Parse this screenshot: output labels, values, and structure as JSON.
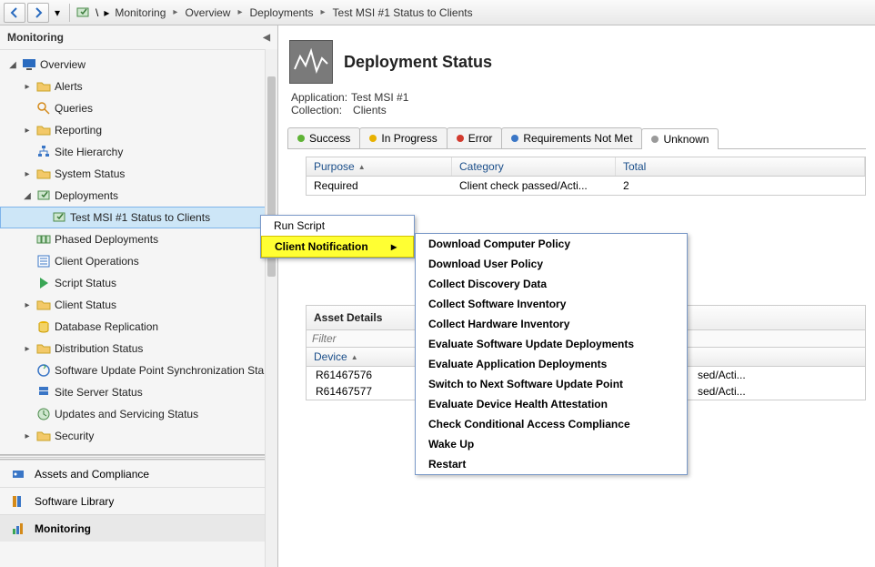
{
  "toolbar": {
    "breadcrumb": [
      "Monitoring",
      "Overview",
      "Deployments",
      "Test MSI #1 Status to Clients"
    ]
  },
  "nav": {
    "header": "Monitoring",
    "tree": {
      "overview": "Overview",
      "alerts": "Alerts",
      "queries": "Queries",
      "reporting": "Reporting",
      "site_hierarchy": "Site Hierarchy",
      "system_status": "System Status",
      "deployments": "Deployments",
      "test_msi": "Test MSI #1 Status to Clients",
      "phased_deployments": "Phased Deployments",
      "client_operations": "Client Operations",
      "script_status": "Script Status",
      "client_status": "Client Status",
      "database_replication": "Database Replication",
      "distribution_status": "Distribution Status",
      "sup_sync": "Software Update Point Synchronization Sta",
      "site_server_status": "Site Server Status",
      "updates_servicing": "Updates and Servicing Status",
      "security": "Security"
    },
    "wunderbar": {
      "assets": "Assets and Compliance",
      "software_library": "Software Library",
      "monitoring": "Monitoring"
    }
  },
  "content": {
    "title": "Deployment Status",
    "meta": {
      "app_label": "Application:",
      "app_value": "Test MSI #1",
      "coll_label": "Collection:",
      "coll_value": "Clients"
    },
    "tabs": {
      "success": "Success",
      "in_progress": "In Progress",
      "error": "Error",
      "req_not_met": "Requirements Not Met",
      "unknown": "Unknown"
    },
    "colors": {
      "success": "#5fb336",
      "in_progress": "#e8b100",
      "error": "#d23a2e",
      "req_not_met": "#3a76c6",
      "unknown": "#9a9a9a"
    },
    "grid": {
      "cols": {
        "purpose": "Purpose",
        "category": "Category",
        "total": "Total"
      },
      "row": {
        "purpose": "Required",
        "category": "Client check passed/Acti...",
        "total": "2"
      }
    },
    "asset": {
      "title": "Asset Details",
      "filter_placeholder": "Filter",
      "cols": {
        "device": "Device",
        "compliance": ""
      },
      "rows": [
        {
          "device": "R61467576",
          "compliance": "sed/Acti..."
        },
        {
          "device": "R61467577",
          "compliance": "sed/Acti..."
        }
      ]
    }
  },
  "context": {
    "menu1": {
      "run_script": "Run Script",
      "client_notification": "Client Notification"
    },
    "menu2": [
      "Download Computer Policy",
      "Download User Policy",
      "Collect Discovery Data",
      "Collect Software Inventory",
      "Collect Hardware Inventory",
      "Evaluate Software Update Deployments",
      "Evaluate Application Deployments",
      "Switch to Next Software Update Point",
      "Evaluate Device Health Attestation",
      "Check Conditional Access Compliance",
      "Wake Up",
      "Restart"
    ]
  }
}
